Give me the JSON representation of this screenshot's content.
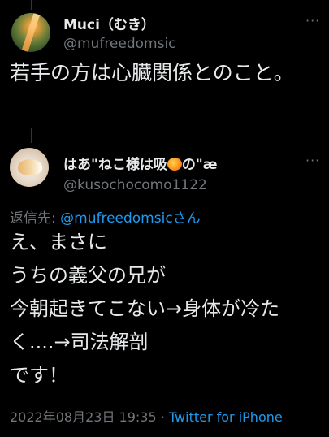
{
  "tweet1": {
    "display_name": "Muci（むき）",
    "handle": "@mufreedomsic",
    "text": "若手の方は心臓関係とのこと。"
  },
  "tweet2": {
    "display_name_prefix": "はあ\"ねこ様は吸",
    "display_name_emoji": "orange-cat-emoji",
    "display_name_suffix": "の\"æ",
    "handle": "@kusochocomo1122",
    "reply_label": "返信先: ",
    "reply_handle": "@mufreedomsic",
    "reply_suffix": "さん",
    "text": "え、まさに\nうちの義父の兄が\n今朝起きてこない→身体が冷たく....→司法解剖\nです！",
    "timestamp": "2022年08月23日 19:35",
    "separator": " · ",
    "client": "Twitter for iPhone"
  },
  "more_icon": "···",
  "colors": {
    "background": "#000000",
    "text": "#e7e9ea",
    "secondary": "#71767b",
    "accent": "#1d9bf0"
  }
}
